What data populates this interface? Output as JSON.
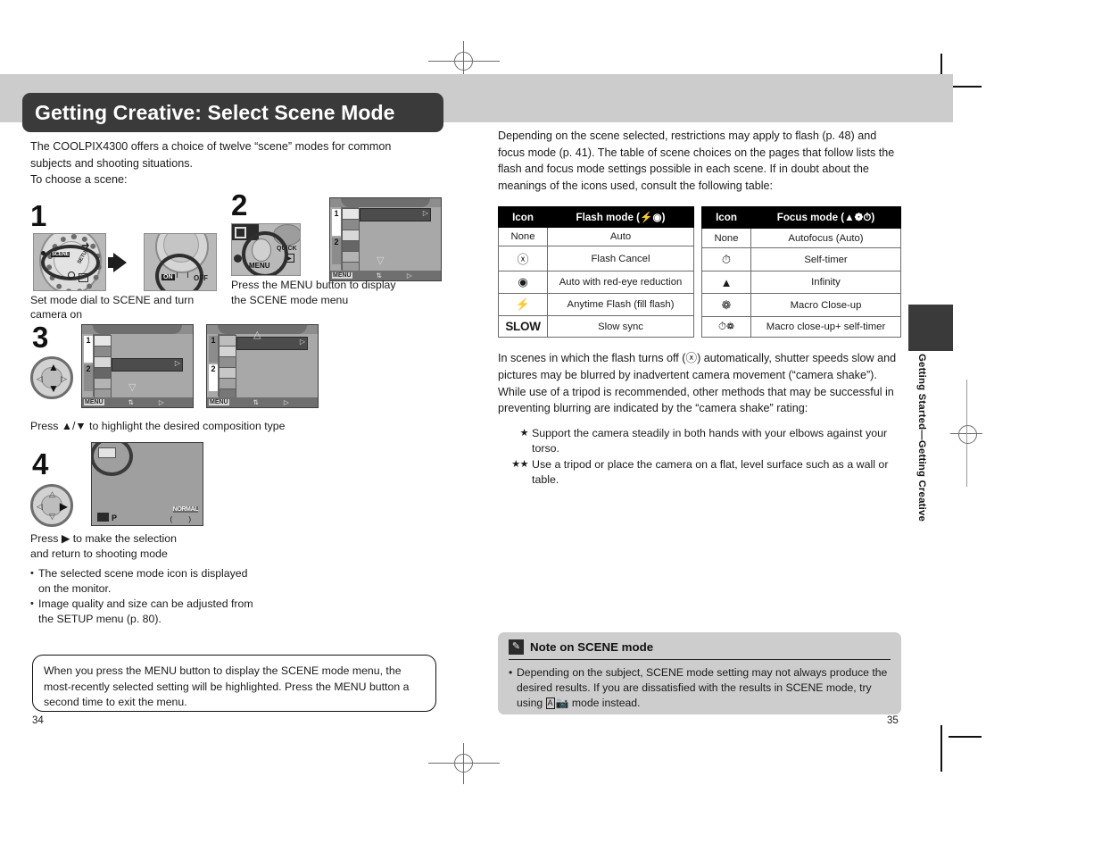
{
  "header": {
    "title": "Getting Creative: Select Scene Mode"
  },
  "left_column": {
    "intro": "The COOLPIX4300 offers a choice of twelve “scene” modes for common subjects and shooting situations.",
    "intro_line2": "To choose a scene:",
    "steps": [
      {
        "number": "1",
        "caption": "Set mode dial to SCENE and turn camera on",
        "dial_label": "SCENE",
        "dial_setup_label": "SETUP",
        "power_on_label": "ON",
        "power_off_label": "OFF"
      },
      {
        "number": "2",
        "caption": "Press the MENU button to display the SCENE mode menu",
        "button_label": "MENU",
        "quick_label": "QUICK",
        "lcd_menu_label": "MENU"
      },
      {
        "number": "3",
        "caption": "Press ▲/▼ to highlight the desired composition type",
        "lcd_menu_label": "MENU",
        "tab1": "1",
        "tab2": "2"
      },
      {
        "number": "4",
        "caption_line1": "Press ▶ to make the selection",
        "caption_line2": "and return to shooting mode",
        "lcd_mode_label": "P",
        "lcd_quality_label": "NORMAL",
        "bullets": [
          "The selected scene mode icon is displayed on the monitor.",
          "Image quality and size can be adjusted from the SETUP menu (p. 80)."
        ]
      }
    ],
    "tip": "When you press the MENU button to display the SCENE mode menu, the most-recently selected setting will be highlighted. Press the MENU button a second time to exit the menu.",
    "page_number": "34"
  },
  "right_column": {
    "intro": "Depending on the scene selected, restrictions may apply to flash (p. 48) and focus mode (p. 41). The table of scene choices on the pages that follow lists the flash and focus mode settings possible in each scene.  If in doubt about the meanings of the icons used, consult the following table:",
    "flash_table": {
      "headers": [
        "Icon",
        "Flash mode (⚡◉)"
      ],
      "rows": [
        {
          "icon": "None",
          "icon_name": "none",
          "label": "Auto"
        },
        {
          "icon": "ⓧ",
          "icon_name": "flash-cancel-icon",
          "label": "Flash Cancel"
        },
        {
          "icon": "◉",
          "icon_name": "red-eye-icon",
          "label": "Auto with red-eye reduction"
        },
        {
          "icon": "⚡",
          "icon_name": "flash-icon",
          "label": "Anytime Flash (fill flash)"
        },
        {
          "icon": "SLOW",
          "icon_name": "slow-sync-icon",
          "label": "Slow sync"
        }
      ]
    },
    "focus_table": {
      "headers": [
        "Icon",
        "Focus mode (▲❁⏱)"
      ],
      "rows": [
        {
          "icon": "None",
          "icon_name": "none",
          "label": "Autofocus (Auto)"
        },
        {
          "icon": "⏱",
          "icon_name": "self-timer-icon",
          "label": "Self-timer"
        },
        {
          "icon": "▲",
          "icon_name": "infinity-mountain-icon",
          "label": "Infinity"
        },
        {
          "icon": "❁",
          "icon_name": "macro-flower-icon",
          "label": "Macro Close-up"
        },
        {
          "icon": "⏱❁",
          "icon_name": "macro-selftimer-icon",
          "label": "Macro close-up+ self-timer"
        }
      ]
    },
    "shake_paragraph": "In scenes in which the flash turns off (ⓧ) automatically, shutter speeds slow and pictures may be blurred by inadvertent camera movement (“camera shake”). While use of a tripod is recommended, other methods that may be successful in preventing blurring are indicated by the “camera shake” rating:",
    "shake_ratings": [
      {
        "stars": "★",
        "text": "Support the camera steadily in both hands with your elbows against your torso."
      },
      {
        "stars": "★★",
        "text": "Use a tripod or place the camera on a flat, level surface such as a wall or table."
      }
    ],
    "note": {
      "title": "Note on SCENE mode",
      "icon_name": "pencil-icon",
      "bullet_pre": "Depending on the subject, SCENE mode setting may not always produce the desired results. If you are dissatisfied with the results in SCENE mode, try using ",
      "bullet_mode_a": "A",
      "bullet_post": " mode instead."
    },
    "page_number": "35"
  },
  "side_tab": {
    "label": "Getting Started—Getting Creative"
  },
  "colors": {
    "header_band": "#cccccc",
    "header_pill": "#3a3a3a",
    "note_box": "#cdcdcd",
    "table_header": "#000000"
  }
}
